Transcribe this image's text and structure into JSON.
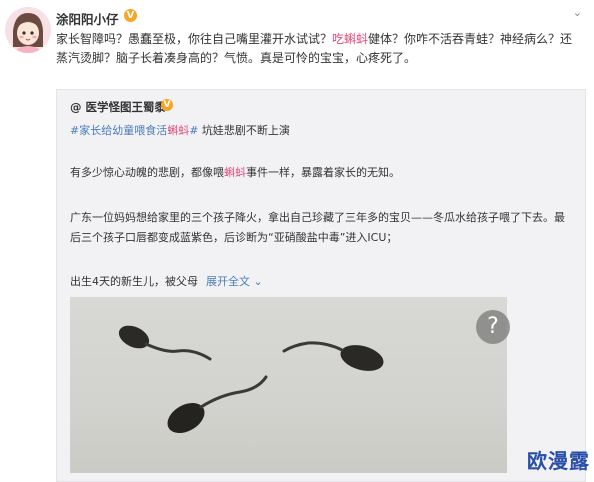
{
  "post": {
    "username": "涂阳阳小仔",
    "verified_badge": "V",
    "menu_icon": "chevron-down-icon",
    "text_before": "家长智障吗？愚蠢至极，你往自己嘴里灌开水试试？",
    "text_highlight": "吃蝌蚪",
    "text_after": "健体？你咋不活吞青蛙？神经病么？还蒸汽烫脚？脑子长着凑身高的？气愤。真是可怜的宝宝，心疼死了。"
  },
  "quoted": {
    "author": "@ 医学怪图王蜀黍",
    "verified_badge": "V",
    "tag_part1": "#家长给幼童喂食活",
    "tag_highlight": "蝌蚪",
    "tag_part3": "#",
    "tagline_rest": " 坑娃悲剧不断上演",
    "p1_before": "有多少惊心动魄的悲剧，都像喂",
    "p1_highlight": "蝌蚪",
    "p1_after": "事件一样，暴露着家长的无知。",
    "p2": "广东一位妈妈想给家里的三个孩子降火，拿出自己珍藏了三年多的宝贝——冬瓜水给孩子喂了下去。最后三个孩子口唇都变成蓝紫色，后诊断为“亚硝酸盐中毒”进入ICU；",
    "p3": "出生4天的新生儿，被父母",
    "more_label": "展开全文",
    "more_icon": "chevron-down-icon",
    "photo_help": "?"
  },
  "watermark": "欧漫露"
}
